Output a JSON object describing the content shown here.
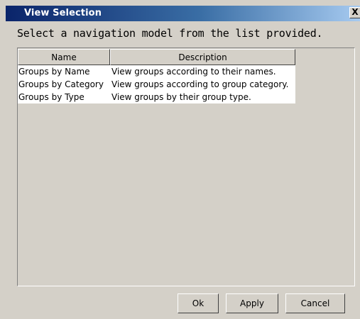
{
  "window": {
    "title": "View Selection",
    "close_label": "X"
  },
  "prompt": "Select a navigation model from the list provided.",
  "table": {
    "columns": [
      "Name",
      "Description"
    ],
    "rows": [
      {
        "name": "Groups by Name",
        "description": "View groups according to their names."
      },
      {
        "name": "Groups by Category",
        "description": "View groups according to group category."
      },
      {
        "name": "Groups by Type",
        "description": "View groups by their group type."
      }
    ]
  },
  "buttons": {
    "ok": "Ok",
    "apply": "Apply",
    "cancel": "Cancel"
  },
  "colors": {
    "dialog_bg": "#d4d0c8",
    "title_start": "#0a246a",
    "title_end": "#a6caf0"
  },
  "icons": {
    "close": "close-icon"
  }
}
